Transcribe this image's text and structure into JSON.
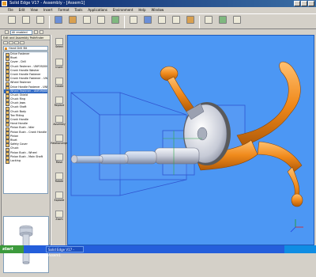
{
  "window": {
    "title": "Solid Edge V17 - Assembly - [Assem1]"
  },
  "menu": [
    "File",
    "Edit",
    "View",
    "Insert",
    "Format",
    "Tools",
    "Applications",
    "Environment",
    "Help",
    "Window"
  ],
  "toolbar": {
    "buttons": [
      "",
      "",
      "",
      "",
      "",
      "",
      "",
      "",
      "",
      "",
      "",
      "",
      "",
      "",
      "",
      "",
      "",
      ""
    ]
  },
  "combo": {
    "value": "All enabled"
  },
  "pathfinder": {
    "header": "Edit and Assembly Pathfinder",
    "root": "Hand Drill Bit",
    "items": [
      "Drive Fastener",
      "Rivet",
      "Cover - Drill",
      "Chuck Fastener - UNF09/0002",
      "Crank Handle Washer",
      "Crank Handle Fastener",
      "Crank Handle Fastener - UNF09",
      "Wheel Fastener",
      "Drive Handle Fastener - UNF09",
      "Wheel Fastener - UNF09/0002",
      "Chuck Shield",
      "Chuck Ring",
      "Chuck Jaws",
      "Chuck Shaft",
      "Chuck Body",
      "Tee Fitting",
      "Crank Handle",
      "Hand Handle",
      "Pinion Bush - Idler",
      "Pinion Bush - Crank Handle",
      "Pinion",
      "Rivet",
      "Safety Cover",
      "Chuck",
      "Pinion Bush - Wheel",
      "Pinion Bush - Main Shaft",
      "Locking"
    ],
    "selected_index": 9
  },
  "commands": [
    "Select",
    "Insert",
    "Create",
    "Replace",
    "Assembly",
    "Relationships",
    "Move",
    "Rotate",
    "Explode",
    "Zoom"
  ],
  "taskbar": {
    "start": "start",
    "task": "Solid Edge V17 - Assem1",
    "clock": ""
  },
  "colors": {
    "viewport": "#4c97f4",
    "part_orange": "#f08a1c",
    "part_grey": "#c8ccd8",
    "selection": "#316ac5"
  }
}
